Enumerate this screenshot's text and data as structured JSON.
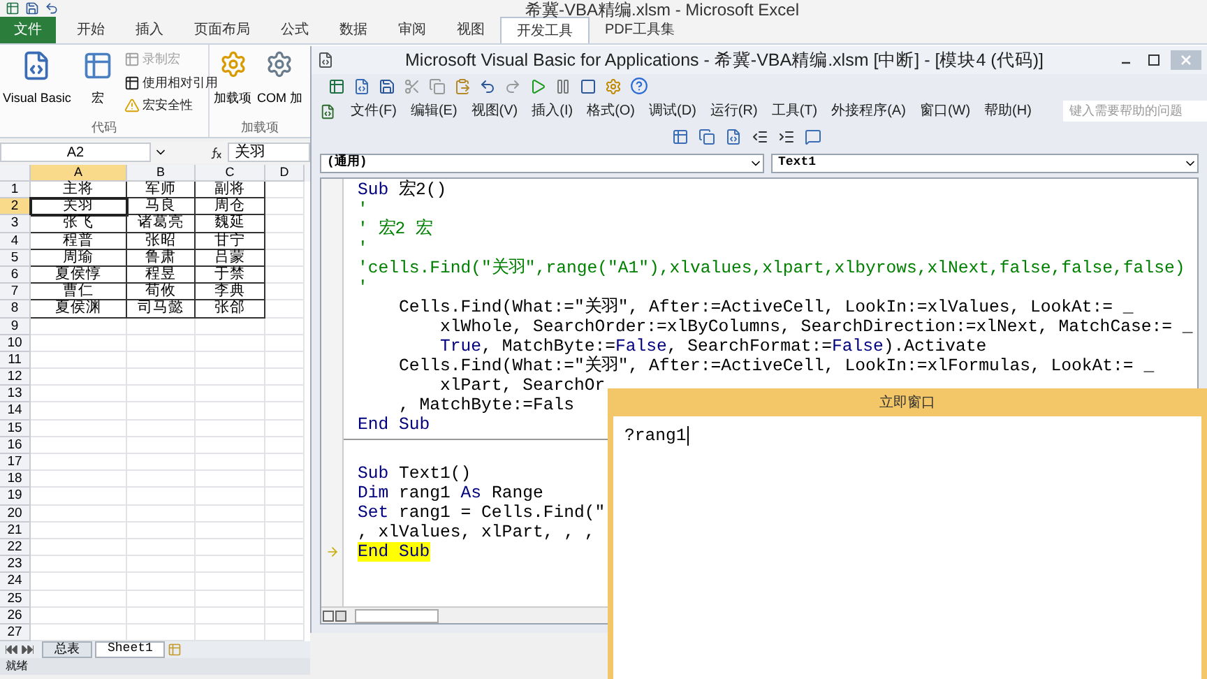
{
  "excel": {
    "title": "希冀-VBA精编.xlsm - Microsoft Excel",
    "tabs": [
      {
        "label": "文件",
        "kind": "file",
        "selected": false
      },
      {
        "label": "开始",
        "kind": "tab",
        "selected": false
      },
      {
        "label": "插入",
        "kind": "tab",
        "selected": false
      },
      {
        "label": "页面布局",
        "kind": "tab",
        "selected": false
      },
      {
        "label": "公式",
        "kind": "tab",
        "selected": false
      },
      {
        "label": "数据",
        "kind": "tab",
        "selected": false
      },
      {
        "label": "审阅",
        "kind": "tab",
        "selected": false
      },
      {
        "label": "视图",
        "kind": "tab",
        "selected": false
      },
      {
        "label": "开发工具",
        "kind": "tab",
        "selected": true
      },
      {
        "label": "PDF工具集",
        "kind": "tab",
        "selected": false
      }
    ],
    "ribbon": {
      "code_group": {
        "label": "代码",
        "visual_basic": "Visual Basic",
        "macros": "宏",
        "small_buttons": [
          {
            "label": "录制宏",
            "disabled": true
          },
          {
            "label": "使用相对引用",
            "disabled": false
          },
          {
            "label": "宏安全性",
            "disabled": false
          }
        ]
      },
      "addins_group": {
        "label": "加载项",
        "addins": "加载项",
        "com_addins": "COM 加"
      }
    },
    "name_box": "A2",
    "formula": "关羽",
    "columns": [
      {
        "label": "A",
        "selected": true
      },
      {
        "label": "B",
        "selected": false
      },
      {
        "label": "C",
        "selected": false
      },
      {
        "label": "D",
        "selected": false
      }
    ],
    "rows": [
      {
        "number": "1",
        "selected": false,
        "cells": [
          "主将",
          "军师",
          "副将"
        ]
      },
      {
        "number": "2",
        "selected": true,
        "cells": [
          "关羽",
          "马良",
          "周仓"
        ]
      },
      {
        "number": "3",
        "selected": false,
        "cells": [
          "张飞",
          "诸葛亮",
          "魏延"
        ]
      },
      {
        "number": "4",
        "selected": false,
        "cells": [
          "程普",
          "张昭",
          "甘宁"
        ]
      },
      {
        "number": "5",
        "selected": false,
        "cells": [
          "周瑜",
          "鲁肃",
          "吕蒙"
        ]
      },
      {
        "number": "6",
        "selected": false,
        "cells": [
          "夏侯惇",
          "程昱",
          "于禁"
        ]
      },
      {
        "number": "7",
        "selected": false,
        "cells": [
          "曹仁",
          "荀攸",
          "李典"
        ]
      },
      {
        "number": "8",
        "selected": false,
        "cells": [
          "夏侯渊",
          "司马懿",
          "张郃"
        ]
      },
      {
        "number": "9",
        "selected": false
      },
      {
        "number": "10",
        "selected": false
      },
      {
        "number": "11",
        "selected": false
      },
      {
        "number": "12",
        "selected": false
      },
      {
        "number": "13",
        "selected": false
      },
      {
        "number": "14",
        "selected": false
      },
      {
        "number": "15",
        "selected": false
      },
      {
        "number": "16",
        "selected": false
      },
      {
        "number": "17",
        "selected": false
      },
      {
        "number": "18",
        "selected": false
      },
      {
        "number": "19",
        "selected": false
      },
      {
        "number": "20",
        "selected": false
      },
      {
        "number": "21",
        "selected": false
      },
      {
        "number": "22",
        "selected": false
      },
      {
        "number": "23",
        "selected": false
      },
      {
        "number": "24",
        "selected": false
      },
      {
        "number": "25",
        "selected": false
      },
      {
        "number": "26",
        "selected": false
      },
      {
        "number": "27",
        "selected": false
      }
    ],
    "sheet_tabs": [
      {
        "label": "总表",
        "selected": false
      },
      {
        "label": "Sheet1",
        "selected": true
      }
    ],
    "status": "就绪"
  },
  "vbe": {
    "title": "Microsoft Visual Basic for Applications - 希冀-VBA精编.xlsm [中断] - [模块4 (代码)]",
    "menu": [
      "文件(F)",
      "编辑(E)",
      "视图(V)",
      "插入(I)",
      "格式(O)",
      "调试(D)",
      "运行(R)",
      "工具(T)",
      "外接程序(A)",
      "窗口(W)",
      "帮助(H)"
    ],
    "help_placeholder": "键入需要帮助的问题",
    "object_dropdown": "(通用)",
    "procedure_dropdown": "Text1",
    "procedures": [
      {
        "lines": [
          {
            "current": false,
            "segments": [
              {
                "kind": "keyword",
                "text": "Sub"
              },
              {
                "kind": "plain",
                "text": " 宏2()"
              }
            ]
          },
          {
            "current": false,
            "segments": [
              {
                "kind": "comment",
                "text": "'"
              }
            ]
          },
          {
            "current": false,
            "segments": [
              {
                "kind": "comment",
                "text": "' 宏2 宏"
              }
            ]
          },
          {
            "current": false,
            "segments": [
              {
                "kind": "comment",
                "text": "'"
              }
            ]
          },
          {
            "current": false,
            "segments": [
              {
                "kind": "comment",
                "text": "'cells.Find(\"关羽\",range(\"A1\"),xlvalues,xlpart,xlbyrows,xlNext,false,false,false)"
              }
            ]
          },
          {
            "current": false,
            "segments": [
              {
                "kind": "comment",
                "text": "'"
              }
            ]
          },
          {
            "current": false,
            "segments": [
              {
                "kind": "plain",
                "text": "    Cells.Find(What:=\"关羽\", After:=ActiveCell, LookIn:=xlValues, LookAt:= _"
              }
            ]
          },
          {
            "current": false,
            "segments": [
              {
                "kind": "plain",
                "text": "        xlWhole, SearchOrder:=xlByColumns, SearchDirection:=xlNext, MatchCase:= _"
              }
            ]
          },
          {
            "current": false,
            "segments": [
              {
                "kind": "keyword",
                "text": "        True"
              },
              {
                "kind": "plain",
                "text": ", MatchByte:="
              },
              {
                "kind": "keyword",
                "text": "False"
              },
              {
                "kind": "plain",
                "text": ", SearchFormat:="
              },
              {
                "kind": "keyword",
                "text": "False"
              },
              {
                "kind": "plain",
                "text": ").Activate"
              }
            ]
          },
          {
            "current": false,
            "segments": [
              {
                "kind": "plain",
                "text": "    Cells.Find(What:=\"关羽\", After:=ActiveCell, LookIn:=xlFormulas, LookAt:= _"
              }
            ]
          },
          {
            "current": false,
            "segments": [
              {
                "kind": "plain",
                "text": "        xlPart, SearchOr"
              }
            ]
          },
          {
            "current": false,
            "segments": [
              {
                "kind": "plain",
                "text": "    , MatchByte:=Fals"
              }
            ]
          },
          {
            "current": false,
            "segments": [
              {
                "kind": "keyword",
                "text": "End Sub"
              }
            ]
          }
        ]
      },
      {
        "lines": [
          {
            "current": false,
            "segments": [
              {
                "kind": "keyword",
                "text": "Sub"
              },
              {
                "kind": "plain",
                "text": " Text1()"
              }
            ]
          },
          {
            "current": false,
            "segments": [
              {
                "kind": "keyword",
                "text": "Dim"
              },
              {
                "kind": "plain",
                "text": " rang1 "
              },
              {
                "kind": "keyword",
                "text": "As"
              },
              {
                "kind": "plain",
                "text": " Range"
              }
            ]
          },
          {
            "current": false,
            "segments": [
              {
                "kind": "keyword",
                "text": "Set"
              },
              {
                "kind": "plain",
                "text": " rang1 = Cells.Find(\""
              }
            ]
          },
          {
            "current": false,
            "segments": [
              {
                "kind": "plain",
                "text": ", xlValues, xlPart, , ,"
              }
            ]
          },
          {
            "current": true,
            "segments": [
              {
                "kind": "keyword",
                "text": "End Sub"
              }
            ]
          }
        ]
      }
    ]
  },
  "immediate": {
    "title": "立即窗口",
    "text": "?rang1"
  }
}
